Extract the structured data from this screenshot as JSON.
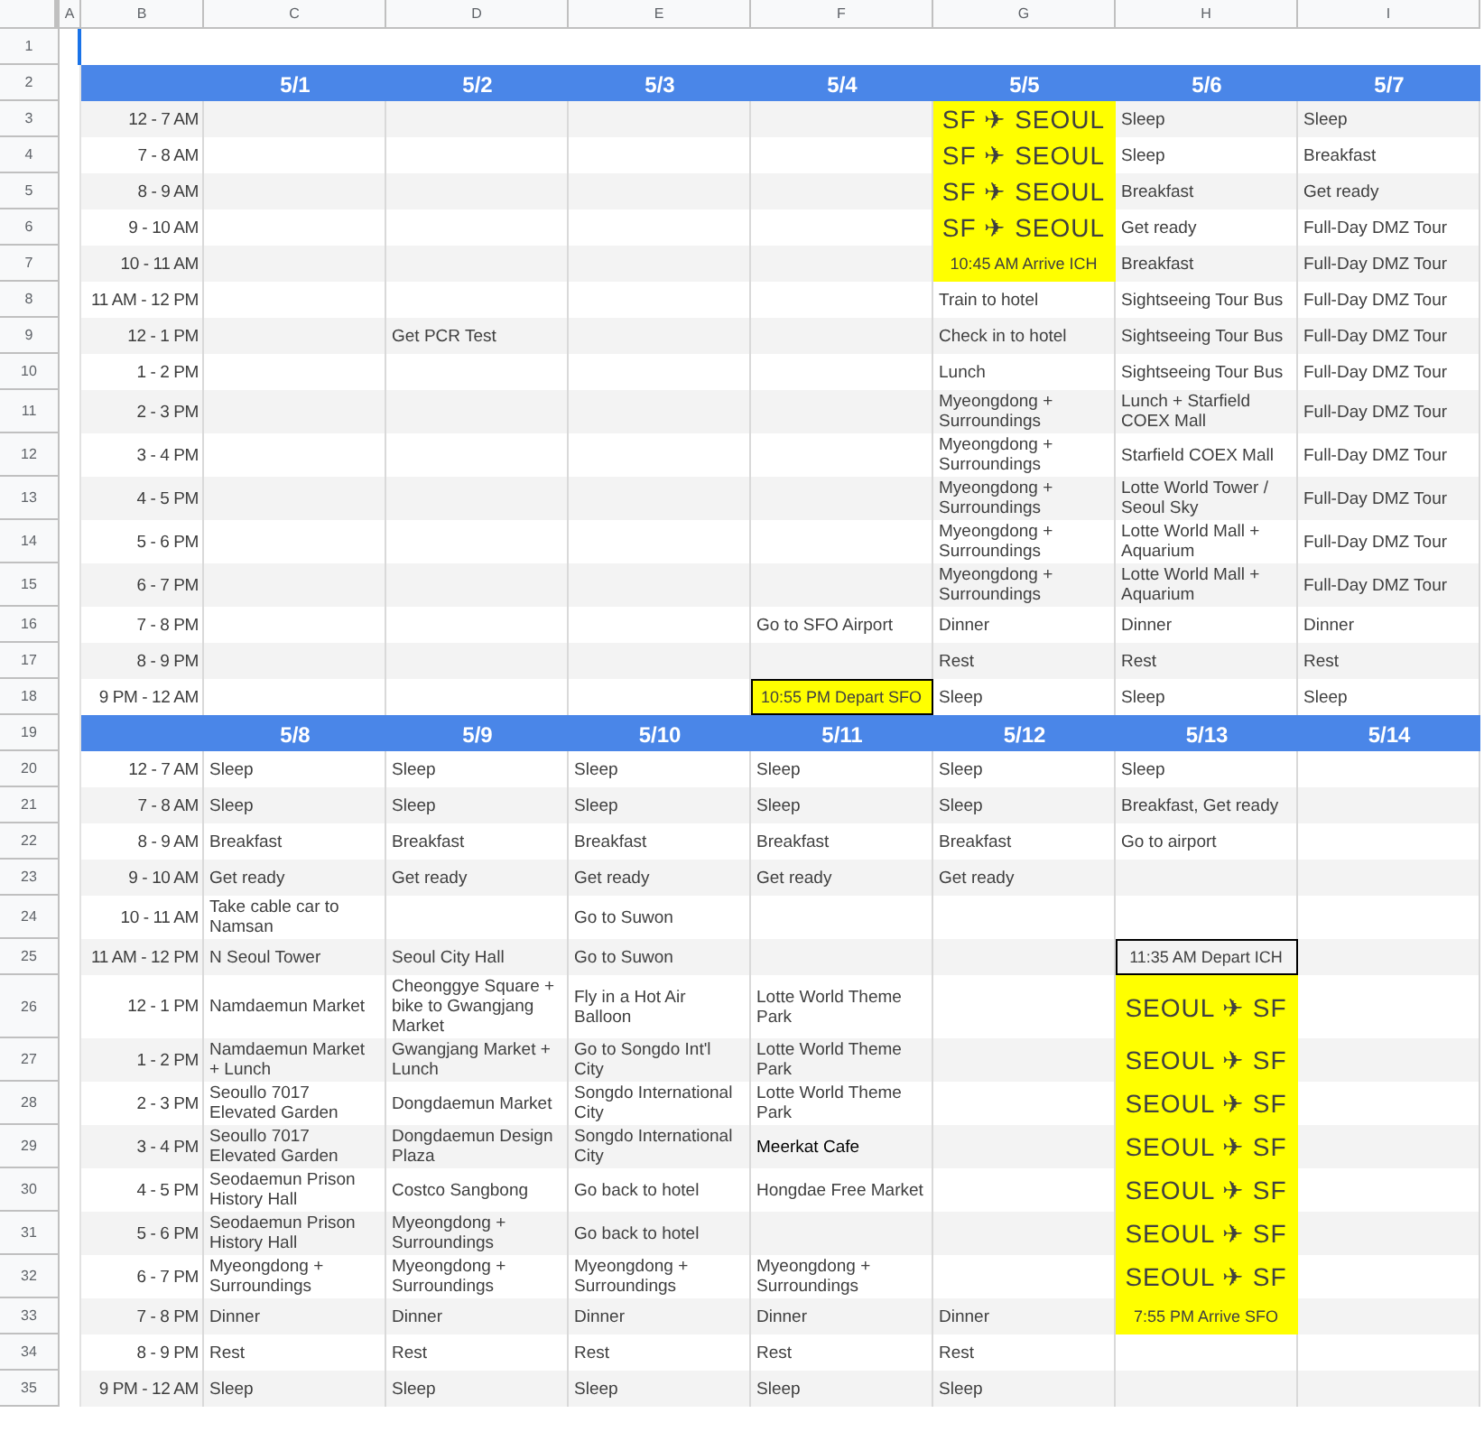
{
  "column_headers": [
    "A",
    "B",
    "C",
    "D",
    "E",
    "F",
    "G",
    "H",
    "I"
  ],
  "top_row": "1",
  "blocks": [
    {
      "row": "2",
      "dates": [
        "5/1",
        "5/2",
        "5/3",
        "5/4",
        "5/5",
        "5/6",
        "5/7"
      ],
      "rows": [
        {
          "row": "3",
          "time": "12 - 7 AM",
          "cells": [
            null,
            null,
            null,
            null,
            {
              "text": "SF ✈ SEOUL",
              "kind": "flight"
            },
            "Sleep",
            "Sleep"
          ]
        },
        {
          "row": "4",
          "time": "7 - 8 AM",
          "cells": [
            null,
            null,
            null,
            null,
            {
              "text": "SF ✈ SEOUL",
              "kind": "flight"
            },
            "Sleep",
            "Breakfast"
          ]
        },
        {
          "row": "5",
          "time": "8 - 9 AM",
          "cells": [
            null,
            null,
            null,
            null,
            {
              "text": "SF ✈ SEOUL",
              "kind": "flight"
            },
            "Breakfast",
            "Get ready"
          ]
        },
        {
          "row": "6",
          "time": "9 - 10 AM",
          "cells": [
            null,
            null,
            null,
            null,
            {
              "text": "SF ✈ SEOUL",
              "kind": "flight"
            },
            "Get ready",
            "Full-Day DMZ Tour"
          ]
        },
        {
          "row": "7",
          "time": "10 - 11 AM",
          "cells": [
            null,
            null,
            null,
            null,
            {
              "text": "10:45 AM Arrive ICH",
              "kind": "note"
            },
            "Breakfast",
            "Full-Day DMZ Tour"
          ]
        },
        {
          "row": "8",
          "time": "11 AM - 12 PM",
          "cells": [
            null,
            null,
            null,
            null,
            "Train to hotel",
            "Sightseeing Tour Bus",
            "Full-Day DMZ Tour"
          ]
        },
        {
          "row": "9",
          "time": "12 - 1 PM",
          "cells": [
            null,
            "Get PCR Test",
            null,
            null,
            "Check in to hotel",
            "Sightseeing Tour Bus",
            "Full-Day DMZ Tour"
          ]
        },
        {
          "row": "10",
          "time": "1 - 2 PM",
          "cells": [
            null,
            null,
            null,
            null,
            "Lunch",
            "Sightseeing Tour Bus",
            "Full-Day DMZ Tour"
          ]
        },
        {
          "row": "11",
          "time": "2 - 3 PM",
          "cells": [
            null,
            null,
            null,
            null,
            "Myeongdong + Surroundings",
            "Lunch + Starfield COEX Mall",
            "Full-Day DMZ Tour"
          ]
        },
        {
          "row": "12",
          "time": "3 - 4 PM",
          "cells": [
            null,
            null,
            null,
            null,
            "Myeongdong + Surroundings",
            "Starfield COEX Mall",
            "Full-Day DMZ Tour"
          ]
        },
        {
          "row": "13",
          "time": "4 - 5 PM",
          "cells": [
            null,
            null,
            null,
            null,
            "Myeongdong + Surroundings",
            "Lotte World Tower / Seoul Sky",
            "Full-Day DMZ Tour"
          ]
        },
        {
          "row": "14",
          "time": "5 - 6 PM",
          "cells": [
            null,
            null,
            null,
            null,
            "Myeongdong + Surroundings",
            "Lotte World Mall + Aquarium",
            "Full-Day DMZ Tour"
          ]
        },
        {
          "row": "15",
          "time": "6 - 7 PM",
          "cells": [
            null,
            null,
            null,
            null,
            "Myeongdong + Surroundings",
            "Lotte World Mall + Aquarium",
            "Full-Day DMZ Tour"
          ]
        },
        {
          "row": "16",
          "time": "7 - 8 PM",
          "cells": [
            null,
            null,
            null,
            "Go to SFO Airport",
            "Dinner",
            "Dinner",
            "Dinner"
          ]
        },
        {
          "row": "17",
          "time": "8 - 9 PM",
          "cells": [
            null,
            null,
            null,
            null,
            "Rest",
            "Rest",
            "Rest"
          ]
        },
        {
          "row": "18",
          "time": "9 PM - 12 AM",
          "cells": [
            null,
            null,
            null,
            {
              "text": "10:55 PM Depart SFO",
              "kind": "depart"
            },
            "Sleep",
            "Sleep",
            "Sleep"
          ]
        }
      ]
    },
    {
      "row": "19",
      "dates": [
        "5/8",
        "5/9",
        "5/10",
        "5/11",
        "5/12",
        "5/13",
        "5/14"
      ],
      "rows": [
        {
          "row": "20",
          "time": "12 - 7 AM",
          "cells": [
            "Sleep",
            "Sleep",
            "Sleep",
            "Sleep",
            "Sleep",
            "Sleep",
            null
          ]
        },
        {
          "row": "21",
          "time": "7 - 8 AM",
          "cells": [
            "Sleep",
            "Sleep",
            "Sleep",
            "Sleep",
            "Sleep",
            "Breakfast, Get ready",
            null
          ]
        },
        {
          "row": "22",
          "time": "8 - 9 AM",
          "cells": [
            "Breakfast",
            "Breakfast",
            "Breakfast",
            "Breakfast",
            "Breakfast",
            "Go to airport",
            null
          ]
        },
        {
          "row": "23",
          "time": "9 - 10 AM",
          "cells": [
            "Get ready",
            "Get ready",
            "Get ready",
            "Get ready",
            "Get ready",
            null,
            null
          ]
        },
        {
          "row": "24",
          "time": "10 - 11 AM",
          "cells": [
            "Take cable car to Namsan",
            null,
            "Go to Suwon",
            null,
            null,
            null,
            null
          ]
        },
        {
          "row": "25",
          "time": "11 AM - 12 PM",
          "cells": [
            "N Seoul Tower",
            "Seoul City Hall",
            "Go to Suwon",
            null,
            null,
            {
              "text": "11:35 AM Depart ICH",
              "kind": "outline"
            },
            null
          ]
        },
        {
          "row": "26",
          "time": "12 - 1 PM",
          "cells": [
            "Namdaemun Market",
            "Cheonggye Square + bike to Gwangjang Market",
            "Fly in a Hot Air Balloon",
            "Lotte World Theme Park",
            null,
            {
              "text": "SEOUL ✈ SF",
              "kind": "flight"
            },
            null
          ]
        },
        {
          "row": "27",
          "time": "1 - 2 PM",
          "cells": [
            "Namdaemun Market + Lunch",
            "Gwangjang Market + Lunch",
            "Go to Songdo Int'l City",
            "Lotte World Theme Park",
            null,
            {
              "text": "SEOUL ✈ SF",
              "kind": "flight"
            },
            null
          ]
        },
        {
          "row": "28",
          "time": "2 - 3 PM",
          "cells": [
            "Seoullo 7017 Elevated Garden",
            "Dongdaemun Market",
            "Songdo International City",
            "Lotte World Theme Park",
            null,
            {
              "text": "SEOUL ✈ SF",
              "kind": "flight"
            },
            null
          ]
        },
        {
          "row": "29",
          "time": "3 - 4 PM",
          "cells": [
            "Seoullo 7017 Elevated Garden",
            "Dongdaemun Design Plaza",
            "Songdo International City",
            {
              "text": "Meerkat Cafe",
              "kind": "dark"
            },
            null,
            {
              "text": "SEOUL ✈ SF",
              "kind": "flight"
            },
            null
          ]
        },
        {
          "row": "30",
          "time": "4 - 5 PM",
          "cells": [
            "Seodaemun Prison History Hall",
            "Costco Sangbong",
            "Go back to hotel",
            "Hongdae Free Market",
            null,
            {
              "text": "SEOUL ✈ SF",
              "kind": "flight"
            },
            null
          ]
        },
        {
          "row": "31",
          "time": "5 - 6 PM",
          "cells": [
            "Seodaemun Prison History Hall",
            "Myeongdong + Surroundings",
            "Go back to hotel",
            null,
            null,
            {
              "text": "SEOUL ✈ SF",
              "kind": "flight"
            },
            null
          ]
        },
        {
          "row": "32",
          "time": "6 - 7 PM",
          "cells": [
            "Myeongdong + Surroundings",
            "Myeongdong + Surroundings",
            "Myeongdong + Surroundings",
            "Myeongdong + Surroundings",
            null,
            {
              "text": "SEOUL ✈ SF",
              "kind": "flight"
            },
            null
          ]
        },
        {
          "row": "33",
          "time": "7 - 8 PM",
          "cells": [
            "Dinner",
            "Dinner",
            "Dinner",
            "Dinner",
            "Dinner",
            {
              "text": "7:55 PM Arrive SFO",
              "kind": "note"
            },
            null
          ]
        },
        {
          "row": "34",
          "time": "8 - 9 PM",
          "cells": [
            "Rest",
            "Rest",
            "Rest",
            "Rest",
            "Rest",
            null,
            null
          ]
        },
        {
          "row": "35",
          "time": "9 PM - 12 AM",
          "cells": [
            "Sleep",
            "Sleep",
            "Sleep",
            "Sleep",
            "Sleep",
            null,
            null
          ]
        }
      ]
    }
  ]
}
